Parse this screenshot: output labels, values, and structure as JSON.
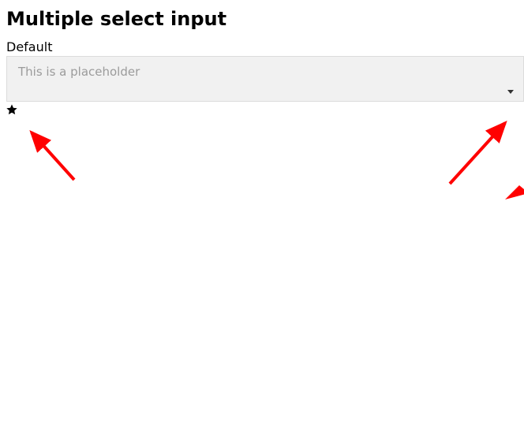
{
  "page": {
    "title": "Multiple select input",
    "field_label": "Default"
  },
  "select": {
    "placeholder": "This is a placeholder"
  },
  "icons": {
    "star": "star-icon",
    "caret": "caret-down-icon"
  },
  "colors": {
    "arrow": "#ff0000",
    "placeholder_text": "#9b9b9b",
    "select_bg": "#f1f1f1",
    "select_border": "#dcdcdc"
  }
}
